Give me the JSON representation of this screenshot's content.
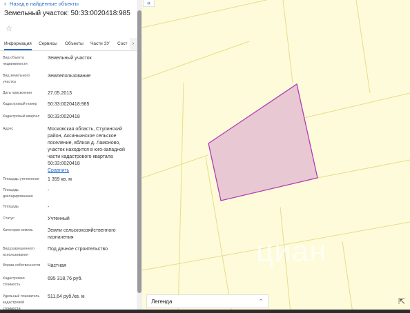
{
  "panel": {
    "back_label": "Назад в найденные объекты",
    "title": "Земельный участок: 50:33:0020418:985",
    "tabs": [
      {
        "label": "Информация"
      },
      {
        "label": "Сервисы"
      },
      {
        "label": "Объекты"
      },
      {
        "label": "Части ЗУ"
      },
      {
        "label": "Сост"
      }
    ],
    "tab_more": "›",
    "properties": [
      {
        "label": "Вид объекта недвижимости",
        "value": "Земельный участок"
      },
      {
        "label": "Вид земельного участка",
        "value": "Землепользование"
      },
      {
        "label": "Дата присвоения",
        "value": "27.05.2013"
      },
      {
        "label": "Кадастровый номер",
        "value": "50:33:0020418:985"
      },
      {
        "label": "Кадастровый квартал",
        "value": "50:33:0020418"
      },
      {
        "label": "Адрес",
        "value": "Московская область, Ступинский район, Аксиньинское сельское поселение, вблизи д. Ламоново, участок находится в юго-западной части кадастрового квартала 50:33:0020418",
        "link": "Сравнить"
      },
      {
        "label": "Площадь уточненная",
        "value": "1 359 кв. м"
      },
      {
        "label": "Площадь декларированная",
        "value": "-"
      },
      {
        "label": "Площадь",
        "value": "-"
      },
      {
        "label": "Статус",
        "value": "Учтенный"
      },
      {
        "label": "Категория земель",
        "value": "Земли сельскохозяйственного назначения"
      },
      {
        "label": "Вид разрешенного использования",
        "value": "Под дачное строительство"
      },
      {
        "label": "Форма собственности",
        "value": "Частная"
      },
      {
        "label": "Кадастровая стоимость",
        "value": "695 318,76 руб."
      },
      {
        "label": "Удельный показатель кадастровой стоимости",
        "value": "511,64 руб./кв. м"
      }
    ]
  },
  "map": {
    "collapse_icon": "«",
    "legend_label": "Легенда",
    "legend_arrow": "⌃⌄",
    "watermark": "циан",
    "parcel_fill": "#e8c8d2",
    "parcel_stroke": "#b23ab5",
    "boundary_color": "#e8dc8a",
    "background": "#fdfbd9"
  },
  "icons": {
    "back": "chevron-left-icon",
    "star": "star-icon",
    "collapse": "double-chevron-left-icon",
    "legend_toggle": "updown-arrows-icon",
    "corner": "map-tool-icon"
  }
}
